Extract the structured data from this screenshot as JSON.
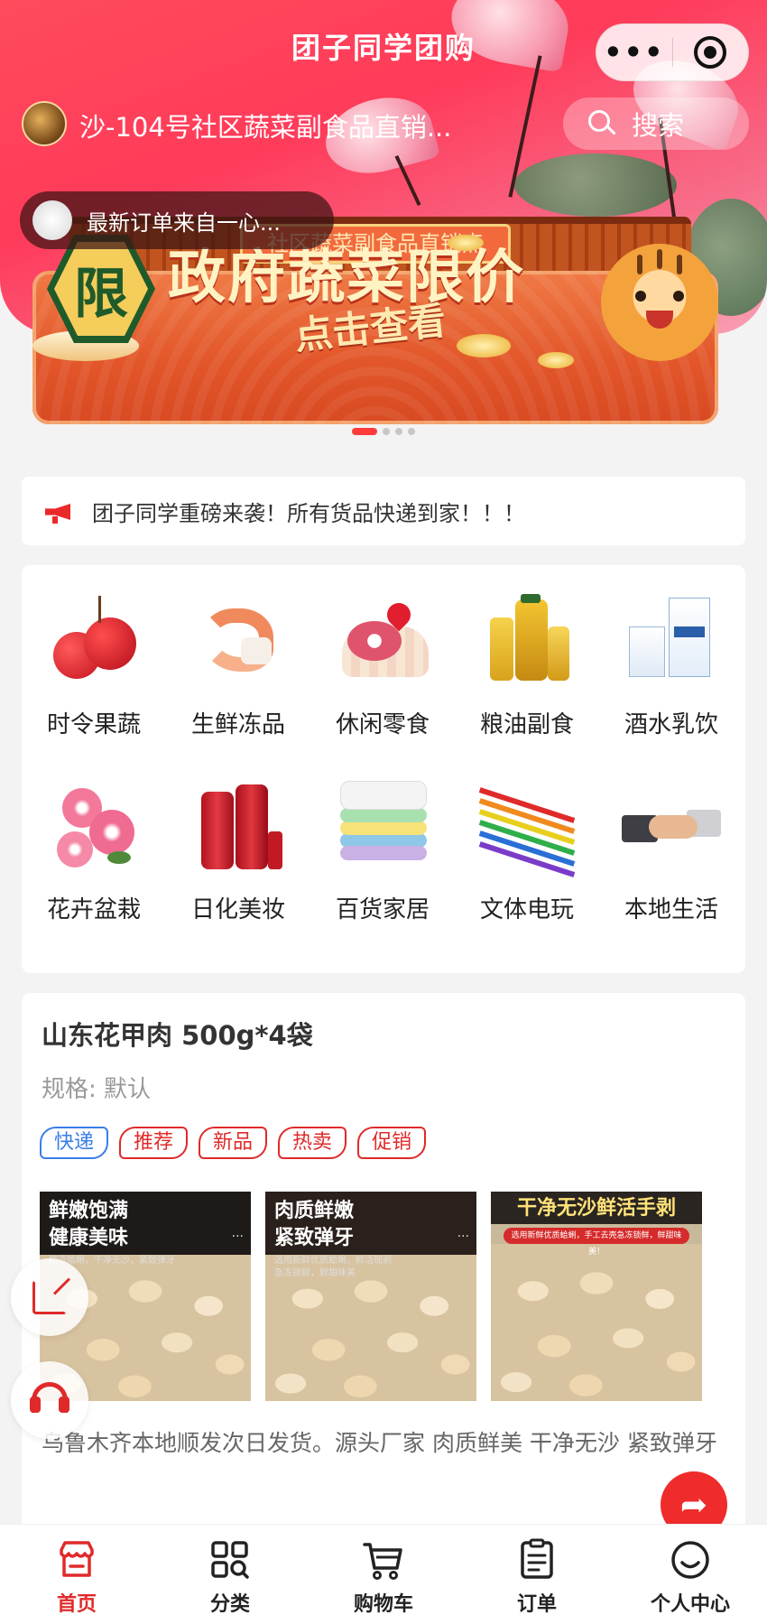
{
  "header": {
    "app_title": "团子同学团购",
    "capsule": {
      "more_icon": "more-dots-icon",
      "close_icon": "target-icon"
    },
    "store_name": "沙-104号社区蔬菜副食品直销...",
    "search_label": "搜索",
    "latest_order": "最新订单来自一心..."
  },
  "banner": {
    "sign_text": "社区蔬菜副食品直销点",
    "badge_text": "限",
    "title": "政府蔬菜限价",
    "cta": "点击查看",
    "slides_total": 4,
    "active_slide": 1
  },
  "notice": {
    "text": "团子同学重磅来袭！所有货品快递到家！！！"
  },
  "categories": [
    {
      "label": "时令果蔬",
      "icon": "lychee-icon"
    },
    {
      "label": "生鲜冻品",
      "icon": "shrimp-icon"
    },
    {
      "label": "休闲零食",
      "icon": "cake-roll-icon"
    },
    {
      "label": "粮油副食",
      "icon": "oil-bottles-icon"
    },
    {
      "label": "酒水乳饮",
      "icon": "milk-cartons-icon"
    },
    {
      "label": "花卉盆栽",
      "icon": "flowers-icon"
    },
    {
      "label": "日化美妆",
      "icon": "shampoo-bottles-icon"
    },
    {
      "label": "百货家居",
      "icon": "towels-icon"
    },
    {
      "label": "文体电玩",
      "icon": "color-pencils-icon"
    },
    {
      "label": "本地生活",
      "icon": "handshake-icon"
    }
  ],
  "product": {
    "title": "山东花甲肉 500g*4袋",
    "spec": "规格: 默认",
    "tags": [
      "快递",
      "推荐",
      "新品",
      "热卖",
      "促销"
    ],
    "images": [
      {
        "caption_line1": "鲜嫩饱满",
        "caption_line2": "健康美味",
        "sub": "精选蛤蜊，干净无沙，紧致弹牙"
      },
      {
        "caption_line1": "肉质鲜嫩",
        "caption_line2": "紧致弹牙",
        "sub": "选用新鲜优质蛤蜊，鲜活现剥 急冻锁鲜，鲜甜味美"
      },
      {
        "caption_line1": "干净无沙鲜活手剥",
        "caption_line2": "",
        "sub": "选用新鲜优质蛤蜊，手工去壳急冻锁鲜，鲜甜味美！"
      }
    ],
    "description": "乌鲁木齐本地顺发次日发货。源头厂家 肉质鲜美 干净无沙 紧致弹牙"
  },
  "floating": {
    "share_icon": "share-icon",
    "support_icon": "headset-icon",
    "forward_icon": "forward-arrow-icon"
  },
  "tabbar": {
    "items": [
      {
        "label": "首页",
        "icon": "store-icon",
        "active": true
      },
      {
        "label": "分类",
        "icon": "category-grid-icon",
        "active": false
      },
      {
        "label": "购物车",
        "icon": "cart-icon",
        "active": false
      },
      {
        "label": "订单",
        "icon": "order-list-icon",
        "active": false
      },
      {
        "label": "个人中心",
        "icon": "smile-user-icon",
        "active": false
      }
    ]
  },
  "colors": {
    "brand_red": "#e02a2a",
    "header_gradient_start": "#ff4a5c",
    "tag_blue": "#3a7ee6"
  }
}
